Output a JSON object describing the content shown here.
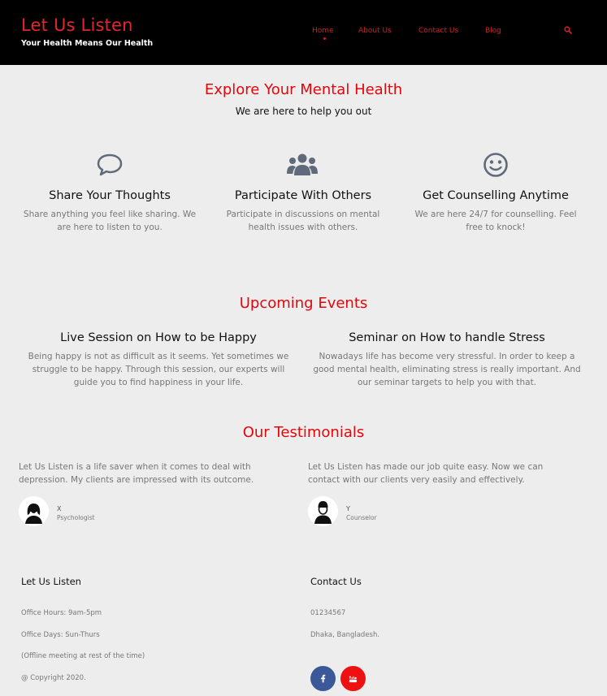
{
  "header": {
    "title": "Let Us Listen",
    "subtitle": "Your Health Means Our Health",
    "nav": [
      "Home",
      "About Us",
      "Contact Us",
      "Blog"
    ],
    "active": "Home",
    "search_icon": "search-icon",
    "accent": "#e4262b"
  },
  "explore": {
    "title": "Explore Your Mental Health",
    "subtitle": "We are here to help you out",
    "features": [
      {
        "icon": "chat-bubble-icon",
        "title": "Share Your Thoughts",
        "text_line1": "Share anything you feel like sharing. We",
        "text_line2": "are here to listen to you."
      },
      {
        "icon": "users-icon",
        "title": "Participate With Others",
        "text_line1": "Participate in discussions on mental",
        "text_line2": "health issues with others."
      },
      {
        "icon": "smile-icon",
        "title": "Get Counselling Anytime",
        "text_line1": "We are here 24/7 for counselling. Feel",
        "text_line2": "free to knock!"
      }
    ]
  },
  "events": {
    "title": "Upcoming Events",
    "items": [
      {
        "title": "Live Session on How to be Happy",
        "line1": "Being happy is not as difficult as it seems. Yet sometimes we",
        "line2": "struggle to be happy. Through this session, our experts will",
        "line3": "guide you to find happiness in your life."
      },
      {
        "title": "Seminar on How to handle Stress",
        "line1": "Nowadays life has become very stressful. In order to keep a",
        "line2": "good mental health, eliminating stress is really important. And",
        "line3": "our seminar targets to help you with that."
      }
    ]
  },
  "testimonials": {
    "title": "Our Testimonials",
    "items": [
      {
        "line1": "Let Us Listen is a life saver when it comes to deal with",
        "line2": "depression. My clients are impressed with its outcome.",
        "name": "X",
        "role": "Psychologist"
      },
      {
        "line1": "Let Us Listen has made our job quite easy. Now we can",
        "line2": "contact with our clients very easily and effectively.",
        "name": "Y",
        "role": "Counselor"
      }
    ]
  },
  "footer": {
    "left": {
      "title": "Let Us Listen",
      "lines": [
        "Office Hours: 9am-5pm",
        "Office Days: Sun-Thurs",
        "(Offline meeting at rest of the time)",
        "@ Copyright 2020."
      ]
    },
    "right": {
      "title": "Contact Us",
      "lines": [
        "01234567",
        "Dhaka, Bangladesh."
      ],
      "social": [
        {
          "icon": "facebook-icon",
          "color": "#3b5998"
        },
        {
          "icon": "youtube-icon",
          "color": "#ee1111"
        }
      ]
    }
  }
}
